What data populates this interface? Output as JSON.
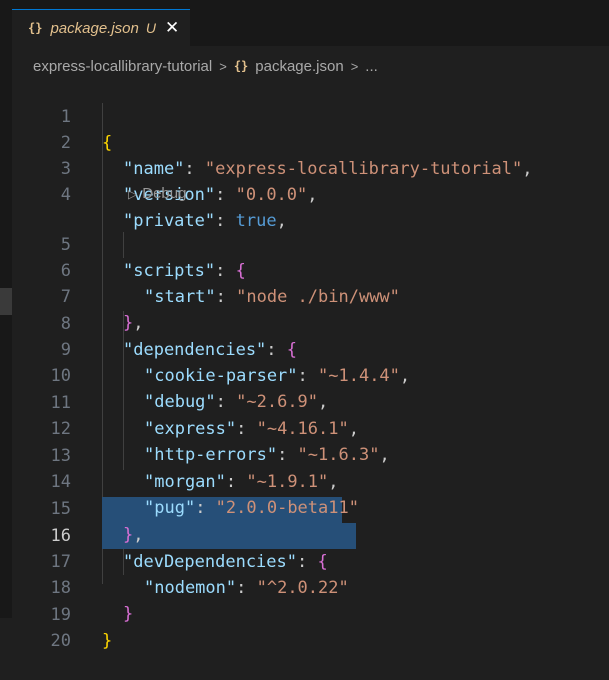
{
  "tab": {
    "icon": "{}",
    "title": "package.json",
    "status": "U",
    "close": "✕"
  },
  "breadcrumb": {
    "folder": "express-locallibrary-tutorial",
    "sep": ">",
    "icon": "{}",
    "file": "package.json",
    "more": "..."
  },
  "codelens": {
    "icon": "▷",
    "label": "Debug"
  },
  "editor": {
    "line_numbers": [
      "1",
      "2",
      "3",
      "4",
      "5",
      "6",
      "7",
      "8",
      "9",
      "10",
      "11",
      "12",
      "13",
      "14",
      "15",
      "16",
      "17",
      "18",
      "19",
      "20"
    ],
    "active_line": "16",
    "tokens": {
      "l1": {
        "brace": "{"
      },
      "l2": {
        "key": "\"name\"",
        "colon": ": ",
        "val": "\"express-locallibrary-tutorial\"",
        "comma": ","
      },
      "l3": {
        "key": "\"version\"",
        "colon": ": ",
        "val": "\"0.0.0\"",
        "comma": ","
      },
      "l4": {
        "key": "\"private\"",
        "colon": ": ",
        "val": "true",
        "comma": ","
      },
      "l5": {
        "key": "\"scripts\"",
        "colon": ": ",
        "brace": "{"
      },
      "l6": {
        "key": "\"start\"",
        "colon": ": ",
        "val": "\"node ./bin/www\""
      },
      "l7": {
        "brace": "}",
        "comma": ","
      },
      "l8": {
        "key": "\"dependencies\"",
        "colon": ": ",
        "brace": "{"
      },
      "l9": {
        "key": "\"cookie-parser\"",
        "colon": ": ",
        "val": "\"~1.4.4\"",
        "comma": ","
      },
      "l10": {
        "key": "\"debug\"",
        "colon": ": ",
        "val": "\"~2.6.9\"",
        "comma": ","
      },
      "l11": {
        "key": "\"express\"",
        "colon": ": ",
        "val": "\"~4.16.1\"",
        "comma": ","
      },
      "l12": {
        "key": "\"http-errors\"",
        "colon": ": ",
        "val": "\"~1.6.3\"",
        "comma": ","
      },
      "l13": {
        "key": "\"morgan\"",
        "colon": ": ",
        "val": "\"~1.9.1\"",
        "comma": ","
      },
      "l14": {
        "key": "\"pug\"",
        "colon": ": ",
        "val": "\"2.0.0-beta11\""
      },
      "l15": {
        "brace": "}",
        "comma": ","
      },
      "l16": {
        "key": "\"devDependencies\"",
        "colon": ": ",
        "brace": "{"
      },
      "l17": {
        "key": "\"nodemon\"",
        "colon": ": ",
        "val": "\"^2.0.22\""
      },
      "l18": {
        "brace": "}"
      },
      "l19": {
        "brace": "}"
      }
    }
  },
  "colors": {
    "key": "#9cdcfe",
    "string": "#ce9178",
    "boolean": "#569cd6",
    "bracket_level1": "#ffd700",
    "bracket_level2": "#da70d6",
    "selection": "#264f78",
    "modified_file": "#e2c08d"
  }
}
